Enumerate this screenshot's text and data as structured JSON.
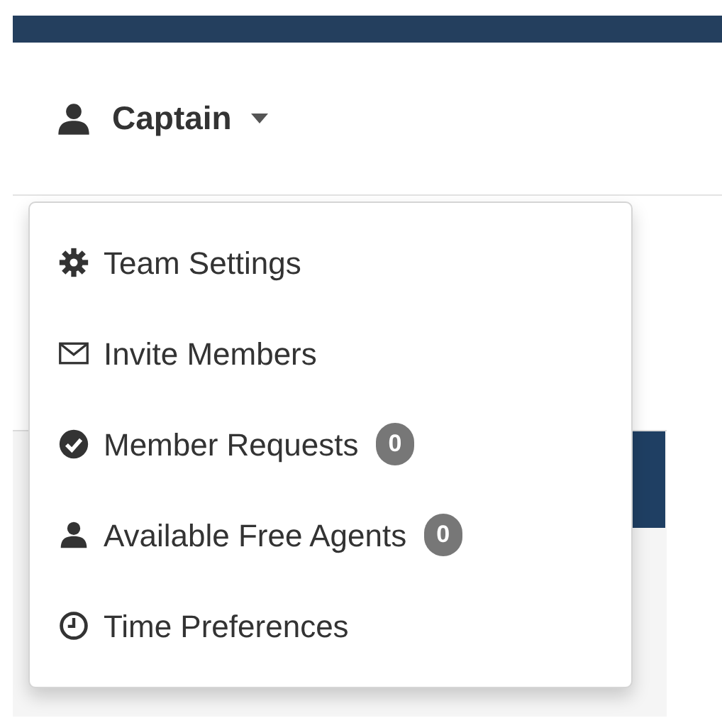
{
  "user_menu": {
    "label": "Captain",
    "expanded": true
  },
  "menu_items": [
    {
      "label": "Team Settings"
    },
    {
      "label": "Invite Members"
    },
    {
      "label": "Member Requests",
      "badge": "0"
    },
    {
      "label": "Available Free Agents",
      "badge": "0"
    },
    {
      "label": "Time Preferences"
    }
  ]
}
